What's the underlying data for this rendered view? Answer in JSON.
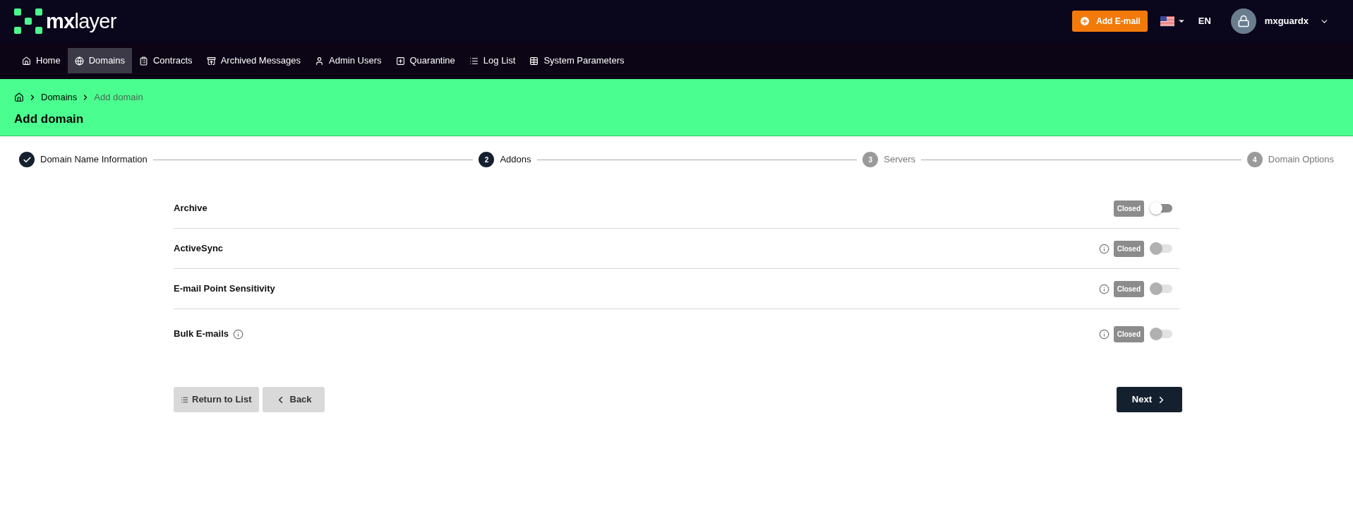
{
  "header": {
    "logo": "mxlayer",
    "add_button": "Add E-mail",
    "language": "EN",
    "user": "mxguardx"
  },
  "nav": [
    {
      "label": "Home",
      "selected": false
    },
    {
      "label": "Domains",
      "selected": true
    },
    {
      "label": "Contracts",
      "selected": false
    },
    {
      "label": "Archived Messages",
      "selected": false
    },
    {
      "label": "Admin Users",
      "selected": false
    },
    {
      "label": "Quarantine",
      "selected": false
    },
    {
      "label": "Log List",
      "selected": false
    },
    {
      "label": "System Parameters",
      "selected": false
    }
  ],
  "breadcrumb": [
    {
      "label": "Domains",
      "current": false
    },
    {
      "label": "Add domain",
      "current": true
    }
  ],
  "page_title": "Add domain",
  "steps": [
    {
      "label": "Domain Name Information",
      "kind": "completed"
    },
    {
      "number": "2",
      "label": "Addons",
      "kind": "current"
    },
    {
      "number": "3",
      "label": "Servers",
      "kind": "pending"
    },
    {
      "number": "4",
      "label": "Domain Options",
      "kind": "pending"
    }
  ],
  "addons": [
    {
      "label": "Archive",
      "status": "Closed",
      "on": false,
      "disabled": false
    },
    {
      "label": "ActiveSync",
      "info": true,
      "status": "Closed",
      "on": false,
      "disabled": true
    },
    {
      "label": "E-mail Point Sensitivity",
      "info": true,
      "status": "Closed",
      "on": false,
      "disabled": true
    },
    {
      "label": "Bulk E-mails",
      "label_info": true,
      "info": true,
      "status": "Closed",
      "on": false,
      "disabled": true
    }
  ],
  "buttons": {
    "return": "Return to List",
    "back": "Back",
    "next": "Next"
  }
}
